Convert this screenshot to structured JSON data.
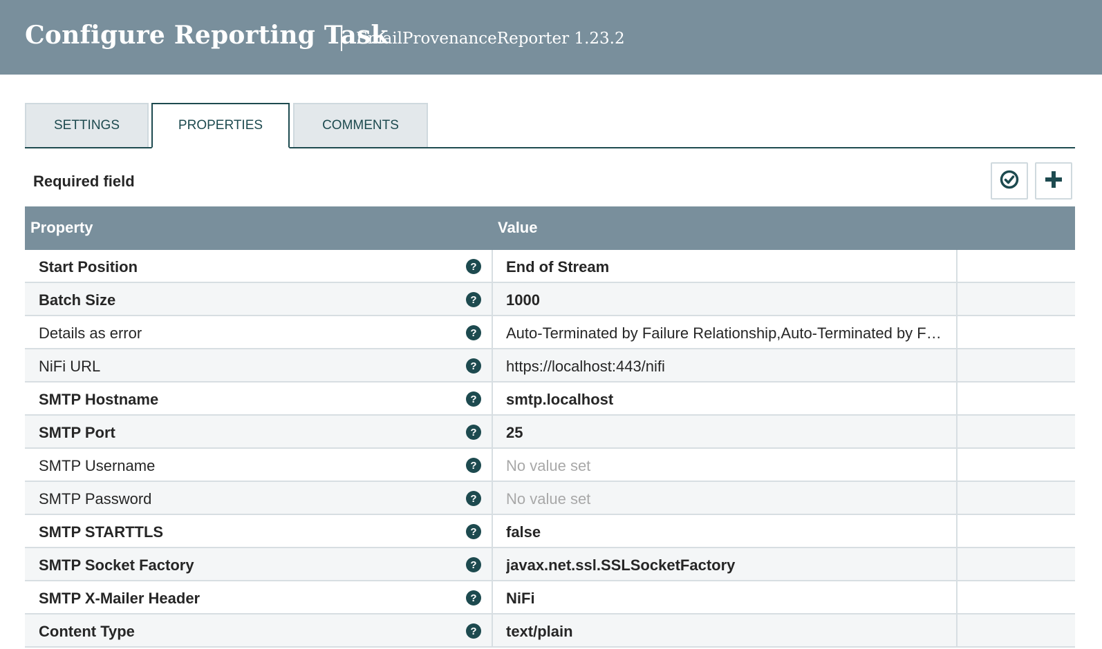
{
  "header": {
    "title": "Configure Reporting Task",
    "subtitle": "EmailProvenanceReporter 1.23.2"
  },
  "tabs": [
    {
      "label": "SETTINGS",
      "active": false
    },
    {
      "label": "PROPERTIES",
      "active": true
    },
    {
      "label": "COMMENTS",
      "active": false
    }
  ],
  "toolbar": {
    "required_label": "Required field",
    "verify_icon": "check-circle-icon",
    "add_icon": "plus-icon"
  },
  "grid": {
    "columns": {
      "property": "Property",
      "value": "Value"
    },
    "rows": [
      {
        "property": "Start Position",
        "value": "End of Stream",
        "required": true,
        "unset": false
      },
      {
        "property": "Batch Size",
        "value": "1000",
        "required": true,
        "unset": false
      },
      {
        "property": "Details as error",
        "value": "Auto-Terminated by Failure Relationship,Auto-Terminated by Failure Relationship",
        "required": false,
        "unset": false
      },
      {
        "property": "NiFi URL",
        "value": "https://localhost:443/nifi",
        "required": false,
        "unset": false
      },
      {
        "property": "SMTP Hostname",
        "value": "smtp.localhost",
        "required": true,
        "unset": false
      },
      {
        "property": "SMTP Port",
        "value": "25",
        "required": true,
        "unset": false
      },
      {
        "property": "SMTP Username",
        "value": "No value set",
        "required": false,
        "unset": true
      },
      {
        "property": "SMTP Password",
        "value": "No value set",
        "required": false,
        "unset": true
      },
      {
        "property": "SMTP STARTTLS",
        "value": "false",
        "required": true,
        "unset": false
      },
      {
        "property": "SMTP Socket Factory",
        "value": "javax.net.ssl.SSLSocketFactory",
        "required": true,
        "unset": false
      },
      {
        "property": "SMTP X-Mailer Header",
        "value": "NiFi",
        "required": true,
        "unset": false
      },
      {
        "property": "Content Type",
        "value": "text/plain",
        "required": true,
        "unset": false
      }
    ]
  },
  "colors": {
    "header_bg": "#798f9c",
    "accent": "#1d4a4f",
    "row_alt": "#f4f6f7",
    "unset_text": "#a8a8a8"
  }
}
